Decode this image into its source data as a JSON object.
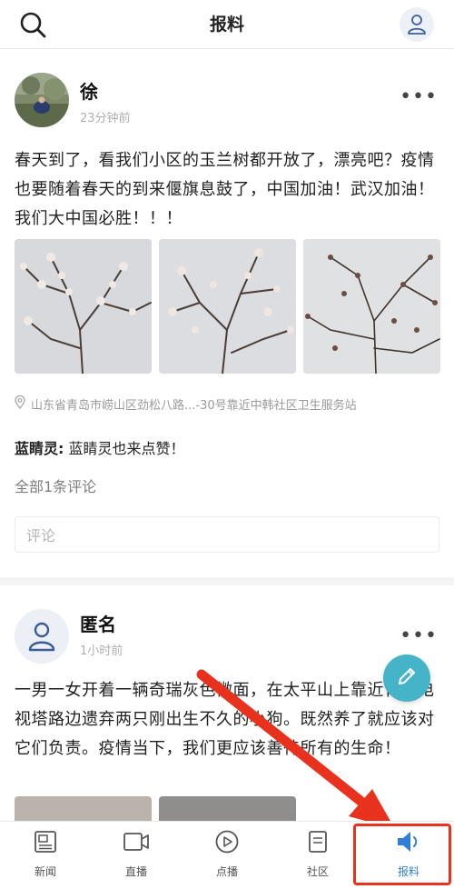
{
  "header": {
    "title": "报料"
  },
  "posts": [
    {
      "author": "徐",
      "time": "23分钟前",
      "text": "春天到了，看我们小区的玉兰树都开放了，漂亮吧？疫情也要随着春天的到来偃旗息鼓了，中国加油！武汉加油！我们大中国必胜！！！",
      "location": "山东省青岛市崂山区劲松八路...-30号靠近中韩社区卫生服务站",
      "reply_author": "蓝睛灵:",
      "reply_text": "蓝睛灵也来点赞！",
      "comment_count": "全部1条评论",
      "comment_placeholder": "评论"
    },
    {
      "author": "匿名",
      "time": "1小时前",
      "text": "一男一女开着一辆奇瑞灰色微面，在太平山上靠近青岛电视塔路边遗弃两只刚出生不久的小狗。既然养了就应该对它们负责。疫情当下，我们更应该善待所有的生命！"
    }
  ],
  "tabs": [
    {
      "label": "新闻",
      "icon": "news-icon"
    },
    {
      "label": "直播",
      "icon": "live-video-icon"
    },
    {
      "label": "点播",
      "icon": "play-icon"
    },
    {
      "label": "社区",
      "icon": "community-icon"
    },
    {
      "label": "报料",
      "icon": "speaker-icon",
      "active": true
    }
  ],
  "colors": {
    "accent": "#2f7fd6",
    "fab": "#46b4c8",
    "highlight": "#e8321e"
  }
}
